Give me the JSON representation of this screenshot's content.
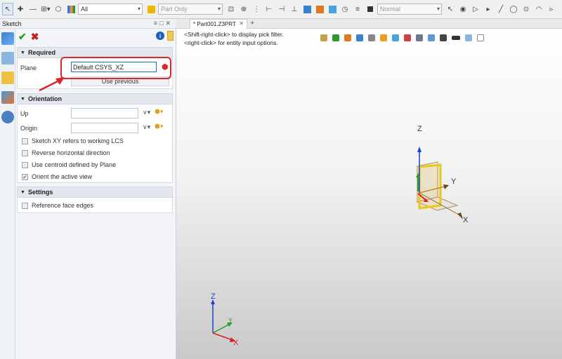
{
  "toolbar": {
    "filter_value": "All",
    "scope_value": "Part Only",
    "style_value": "Normal"
  },
  "panel": {
    "title": "Sketch",
    "required": {
      "header": "Required",
      "plane_label": "Plane",
      "plane_value": "Default CSYS_XZ",
      "use_previous_label": "Use previous"
    },
    "orientation": {
      "header": "Orientation",
      "up_label": "Up",
      "up_value": "",
      "origin_label": "Origin",
      "origin_value": "",
      "options": [
        {
          "label": "Sketch XY refers to working LCS",
          "checked": false
        },
        {
          "label": "Reverse horizontal direction",
          "checked": false
        },
        {
          "label": "Use centroid defined by Plane",
          "checked": false
        },
        {
          "label": "Orient the active view",
          "checked": true
        }
      ]
    },
    "settings": {
      "header": "Settings",
      "options": [
        {
          "label": "Reference face edges",
          "checked": false
        }
      ]
    }
  },
  "document": {
    "tab_label": "* Part001.Z3PRT",
    "hint_line1": "<Shift-right-click> to display pick filter.",
    "hint_line2": "<right-click> for entity input options."
  },
  "triad": {
    "axis_x": "X",
    "axis_y": "Y",
    "axis_z": "Z"
  },
  "colors": {
    "x_axis": "#d62020",
    "y_axis": "#2a9a2a",
    "z_axis": "#1f3fd0",
    "plane_frame": "#e8c81a",
    "highlight": "#d8262d"
  }
}
